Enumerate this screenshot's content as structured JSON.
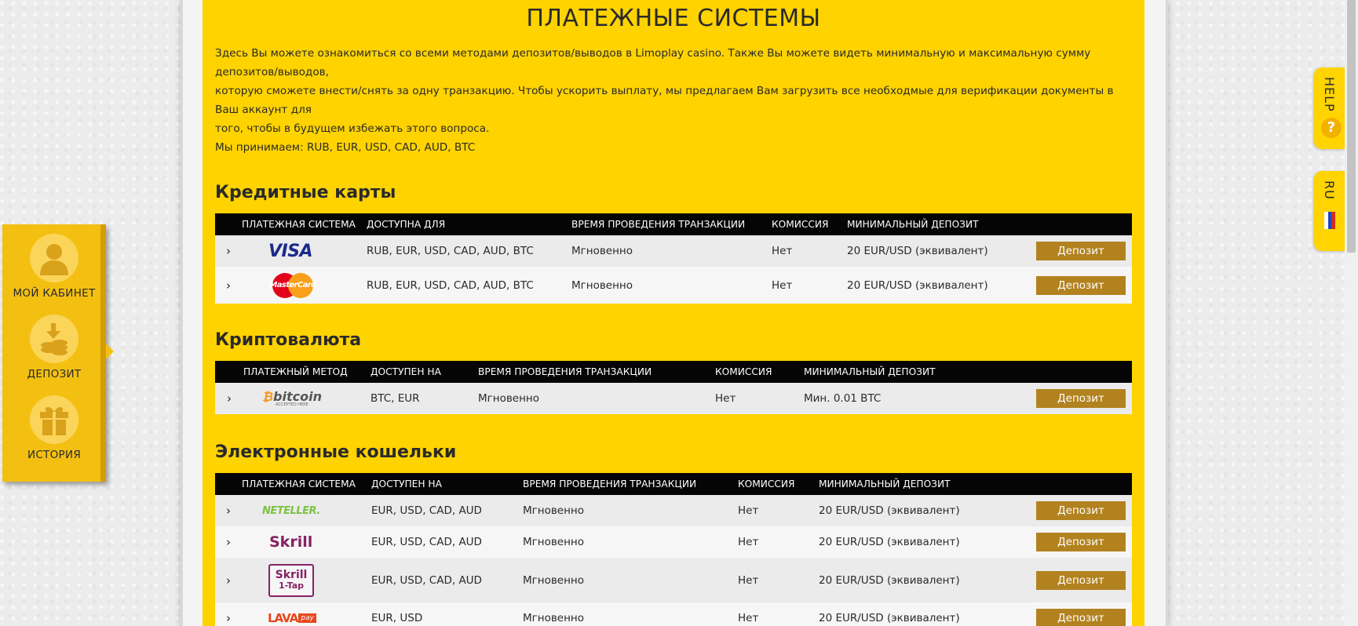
{
  "page_title": "ПЛАТЕЖНЫЕ СИСТЕМЫ",
  "intro": {
    "line1": "Здесь Вы можете ознакомиться со всеми методами депозитов/выводов в Limoplay casino. Также Вы можете видеть минимальную и максимальную сумму депозитов/выводов,",
    "line2": "которую сможете внести/снять за одну транзакцию. Чтобы ускорить выплату, мы предлагаем Вам загрузить все необходмые для верификации документы в Ваш аккаунт для",
    "line3": "того, чтобы в будущем избежать этого вопроса.",
    "line4": "Мы принимаем: RUB, EUR, USD, CAD, AUD, BTC"
  },
  "credit": {
    "title": "Кредитные карты",
    "headers": [
      "ПЛАТЕЖНАЯ СИСТЕМА",
      "ДОСТУПНА ДЛЯ",
      "ВРЕМЯ ПРОВЕДЕНИЯ ТРАНЗАКЦИИ",
      "КОМИССИЯ",
      "МИНИМАЛЬНЫЙ ДЕПОЗИТ"
    ],
    "rows": [
      {
        "logo": "VISA",
        "currencies": "RUB, EUR, USD, CAD, AUD, BTC",
        "time": "Мгновенно",
        "fee": "Нет",
        "min": "20 EUR/USD (эквивалент)",
        "btn": "Депозит"
      },
      {
        "logo": "MasterCard",
        "currencies": "RUB, EUR, USD, CAD, AUD, BTC",
        "time": "Мгновенно",
        "fee": "Нет",
        "min": "20 EUR/USD (эквивалент)",
        "btn": "Депозит"
      }
    ]
  },
  "crypto": {
    "title": "Криптовалюта",
    "headers": [
      "ПЛАТЕЖНЫЙ МЕТОД",
      "ДОСТУПЕН НА",
      "ВРЕМЯ ПРОВЕДЕНИЯ ТРАНЗАКЦИИ",
      "КОМИССИЯ",
      "МИНИМАЛЬНЫЙ ДЕПОЗИТ"
    ],
    "rows": [
      {
        "logo": "bitcoin",
        "logo_sub": "ACCEPTED HERE",
        "currencies": "BTC, EUR",
        "time": "Мгновенно",
        "fee": "Нет",
        "min": "Мин. 0.01 BTC",
        "btn": "Депозит"
      }
    ]
  },
  "ewallet": {
    "title": "Электронные кошельки",
    "headers": [
      "ПЛАТЕЖНАЯ СИСТЕМА",
      "ДОСТУПЕН НА",
      "ВРЕМЯ ПРОВЕДЕНИЯ ТРАНЗАКЦИИ",
      "КОМИССИЯ",
      "МИНИМАЛЬНЫЙ ДЕПОЗИТ"
    ],
    "rows": [
      {
        "logo": "NETELLER.",
        "currencies": "EUR, USD, CAD, AUD",
        "time": "Мгновенно",
        "fee": "Нет",
        "min": "20 EUR/USD (эквивалент)",
        "btn": "Депозит"
      },
      {
        "logo": "Skrill",
        "currencies": "EUR, USD, CAD, AUD",
        "time": "Мгновенно",
        "fee": "Нет",
        "min": "20 EUR/USD (эквивалент)",
        "btn": "Депозит"
      },
      {
        "logo": "Skrill",
        "logo_sub": "1-Tap",
        "currencies": "EUR, USD, CAD, AUD",
        "time": "Мгновенно",
        "fee": "Нет",
        "min": "20 EUR/USD (эквивалент)",
        "btn": "Депозит"
      },
      {
        "logo": "LAVA",
        "logo_sub": "pay",
        "currencies": "EUR, USD",
        "time": "Мгновенно",
        "fee": "Нет",
        "min": "20 EUR/USD (эквивалент)",
        "btn": "Депозит"
      }
    ]
  },
  "side": {
    "cabinet": "МОЙ КАБИНЕТ",
    "deposit": "ДЕПОЗИТ",
    "history": "ИСТОРИЯ"
  },
  "tabs": {
    "help": "HELP",
    "help_q": "?",
    "lang": "RU"
  },
  "colors": {
    "accent": "#ffd300",
    "button": "#b2821f",
    "header": "#050505"
  }
}
